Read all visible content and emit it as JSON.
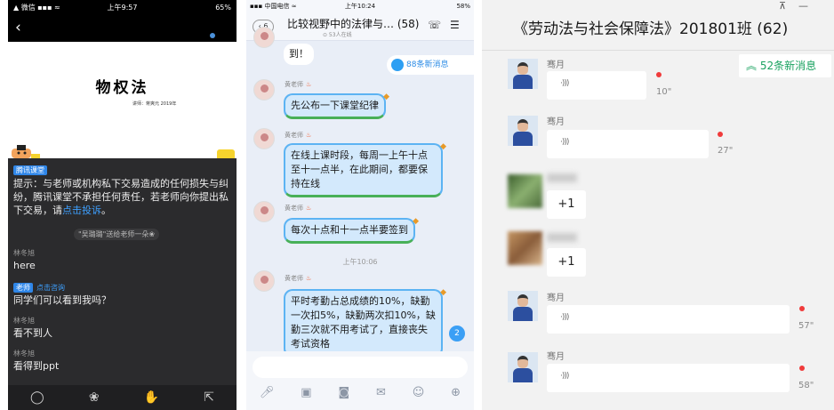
{
  "panel1": {
    "status": {
      "left": "▲ 微信 ▪▪▪ ≈",
      "time": "上午9:57",
      "battery": "65%"
    },
    "slide": {
      "title": "物权法",
      "subtitle": "讲师：蒋爽元    2019年"
    },
    "notice": {
      "tag": "腾讯课堂",
      "text": "提示：与老师或机构私下交易造成的任何损失与纠纷，腾讯课堂不承担任何责任，若老师向你提出私下交易，请",
      "link": "点击投诉",
      "end": "。"
    },
    "gift": "\"吴璐璐\"送给老师一朵❀",
    "messages": [
      {
        "name": "林冬旭",
        "text": "here"
      },
      {
        "tag": "老师",
        "ask": "点击咨询",
        "text": "同学们可以看到我吗？"
      },
      {
        "name": "林冬旭",
        "text": "看不到人"
      },
      {
        "name": "林冬旭",
        "text": "看得到ppt"
      }
    ],
    "bottom_icons": [
      "chat-icon",
      "flower-icon",
      "hand-icon",
      "share-icon"
    ]
  },
  "panel2": {
    "status": {
      "left": "▪▪▪ 中国电信 ≈",
      "time": "上午10:24",
      "battery": "58%"
    },
    "back_count": "6",
    "title": "比较视野中的法律与…  (58)",
    "online": "⊙ 53人在线",
    "first_bubble": "到！",
    "new_messages": "88条新消息",
    "sender": "黄老师",
    "bubbles": [
      "先公布一下课堂纪律",
      "在线上课时段，每周一上午十点至十一点半，在此期间，都要保持在线",
      "每次十点和十一点半要签到",
      "平时考勤占总成绩的10%，缺勤一次扣5%，缺勤两次扣10%，缺勤三次就不用考试了，直接丧失考试资格"
    ],
    "time": "上午10:06",
    "badge": "2",
    "toolbar_icons": [
      "mic-icon",
      "image-icon",
      "camera-icon",
      "red-packet-icon",
      "emoji-icon",
      "plus-icon"
    ]
  },
  "panel3": {
    "title": "《劳动法与社会保障法》201801班 (62)",
    "new_messages": "52条新消息",
    "sender": "骞月",
    "voice_icon": "·)))",
    "voices": [
      {
        "duration": "10\""
      },
      {
        "duration": "27\""
      },
      {
        "duration": "57\""
      },
      {
        "duration": "58\""
      }
    ],
    "plus_one": "+1"
  }
}
